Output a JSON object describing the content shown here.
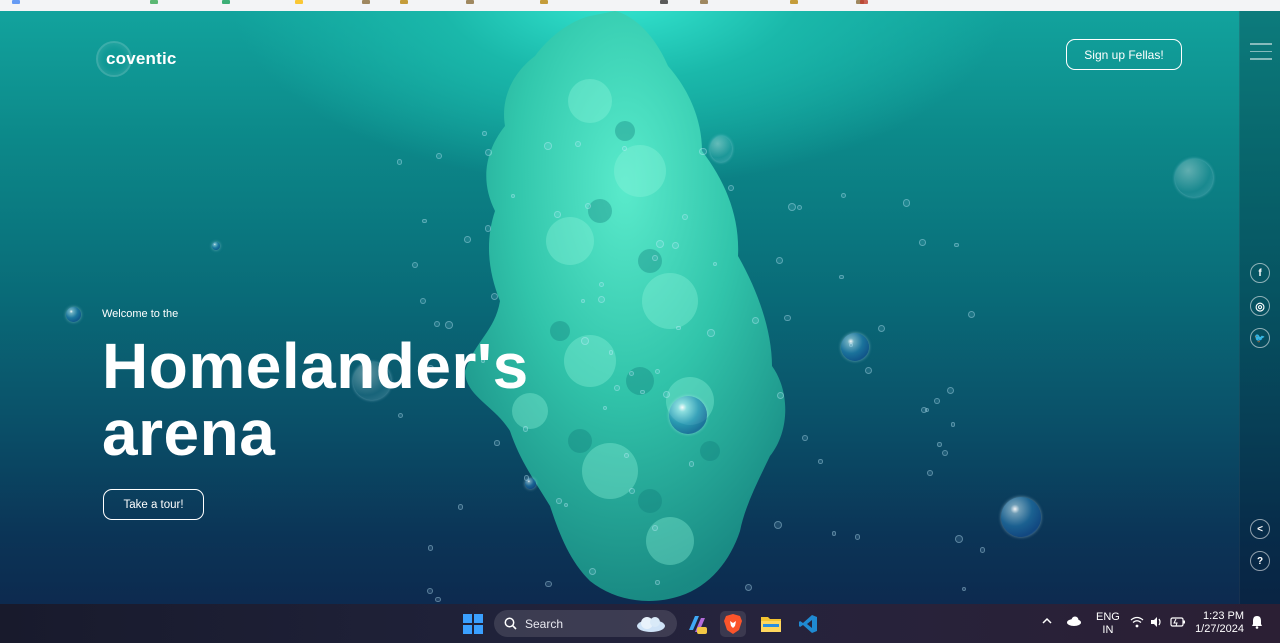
{
  "browser": {
    "bookmark_colors": [
      "#4285f4",
      "#34a853",
      "#0f9d58",
      "#fbbc04",
      "#8a6d3b",
      "#b8860b",
      "#8a6d3b",
      "#b8860b",
      "#333",
      "#8a6d3b",
      "#b8860b",
      "#8a6d3b",
      "#c0392b"
    ]
  },
  "site": {
    "logo_text": "coventic",
    "signup_label": "Sign up Fellas!",
    "welcome_text": "Welcome to the",
    "title_line1": "Homelander's",
    "title_line2": "arena",
    "tour_label": "Take a tour!"
  },
  "sidebar": {
    "social": [
      {
        "name": "facebook-icon",
        "glyph": "f"
      },
      {
        "name": "instagram-icon",
        "glyph": "◎"
      },
      {
        "name": "twitter-icon",
        "glyph": "🐦"
      }
    ],
    "share_glyph": "<",
    "help_glyph": "?"
  },
  "taskbar": {
    "search_label": "Search",
    "language_line1": "ENG",
    "language_line2": "IN",
    "time": "1:23 PM",
    "date": "1/27/2024",
    "colors": {
      "accent": "#1ec8c0",
      "windows_blue": "#3aa0ff",
      "brave": "#fb542b",
      "vscode": "#1f8ad2",
      "explorer": "#f4c430"
    }
  }
}
